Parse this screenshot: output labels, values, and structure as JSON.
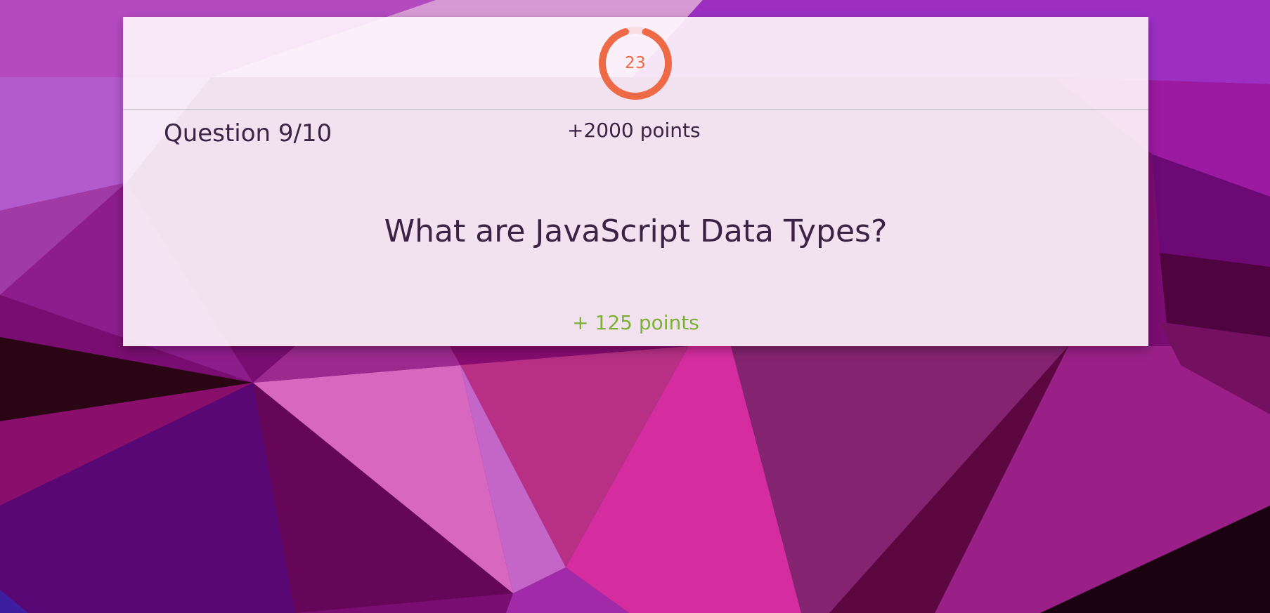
{
  "quiz": {
    "timer": {
      "value": "23",
      "fraction_remaining": 0.9,
      "color": "#ee6a47"
    },
    "question_counter": "Question 9/10",
    "total_points": "+2000 points",
    "question": "What are JavaScript Data Types?",
    "awarded_points": "+ 125 points",
    "colors": {
      "text": "#3b2346",
      "awarded": "#7cb034"
    }
  },
  "background": {
    "style": "low-poly purple/magenta geometric pattern"
  }
}
